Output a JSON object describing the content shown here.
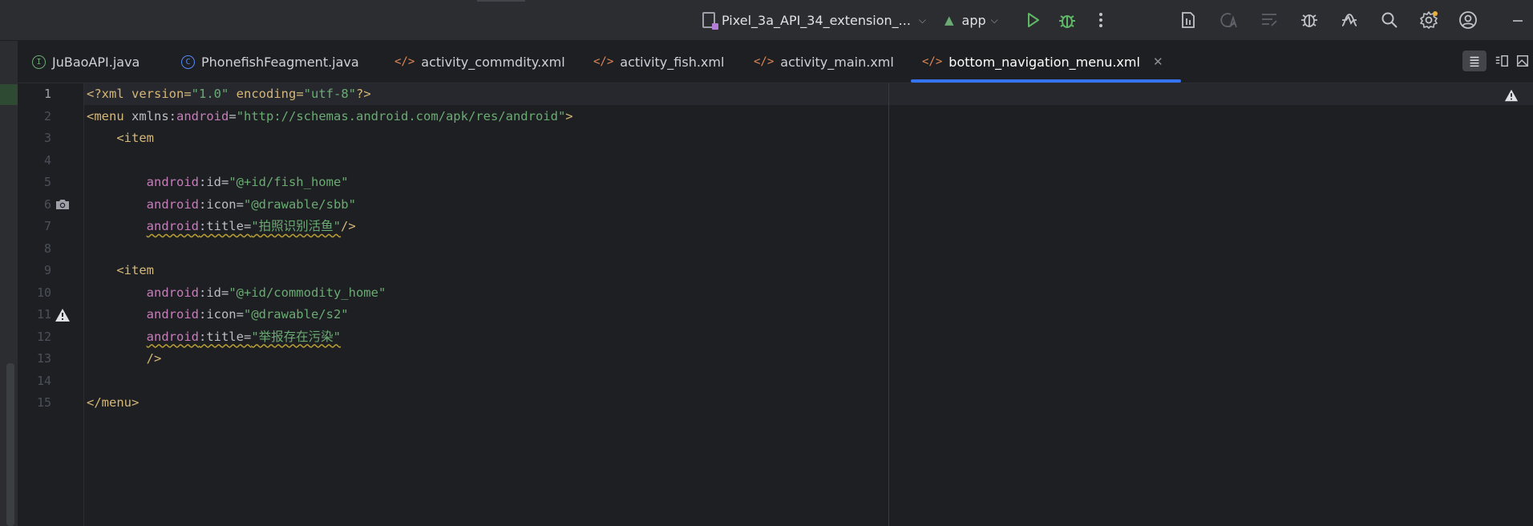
{
  "toolbar": {
    "device_selector": "Pixel_3a_API_34_extension_...",
    "run_config": "app"
  },
  "tabs": [
    {
      "label": "JuBaoAPI.java",
      "icon": "interface-icon",
      "color": "#6aab73"
    },
    {
      "label": "PhonefishFeagment.java",
      "icon": "class-icon",
      "color": "#548af7"
    },
    {
      "label": "activity_commdity.xml",
      "icon": "xml-icon",
      "color": "#e08855"
    },
    {
      "label": "activity_fish.xml",
      "icon": "xml-icon",
      "color": "#e08855"
    },
    {
      "label": "activity_main.xml",
      "icon": "xml-icon",
      "color": "#e08855"
    },
    {
      "label": "bottom_navigation_menu.xml",
      "icon": "xml-icon",
      "color": "#e08855",
      "active": true
    }
  ],
  "editor": {
    "line_numbers": [
      "1",
      "2",
      "3",
      "4",
      "5",
      "6",
      "7",
      "8",
      "9",
      "10",
      "11",
      "12",
      "13",
      "14",
      "15"
    ],
    "current_line": "1",
    "lines": {
      "l1": {
        "a": "<?xml version=",
        "b": "\"1.0\"",
        "c": " encoding=",
        "d": "\"utf-8\"",
        "e": "?>"
      },
      "l2": {
        "a": "<menu ",
        "b": "xmlns",
        "c": ":",
        "d": "android",
        "e": "=",
        "f": "\"http://schemas.android.com/apk/res/android\"",
        "g": ">"
      },
      "l3": {
        "a": "<item"
      },
      "l5": {
        "a": "android",
        "b": ":id=",
        "c": "\"@+id/fish_home\""
      },
      "l6": {
        "a": "android",
        "b": ":icon=",
        "c": "\"@drawable/sbb\""
      },
      "l7": {
        "a": "android",
        "b": ":title=",
        "c": "\"拍照识别活鱼\"",
        "d": "/>"
      },
      "l9": {
        "a": "<item"
      },
      "l10": {
        "a": "android",
        "b": ":id=",
        "c": "\"@+id/commodity_home\""
      },
      "l11": {
        "a": "android",
        "b": ":icon=",
        "c": "\"@drawable/s2\""
      },
      "l12": {
        "a": "android",
        "b": ":title=",
        "c": "\"举报存在污染\""
      },
      "l13": {
        "a": "/>"
      },
      "l15": {
        "a": "</menu>"
      }
    }
  },
  "colors": {
    "accent": "#3574f0",
    "tag": "#d5b778",
    "attribute": "#c77dbb",
    "string": "#6aab73",
    "warning": "#e8b23a"
  }
}
